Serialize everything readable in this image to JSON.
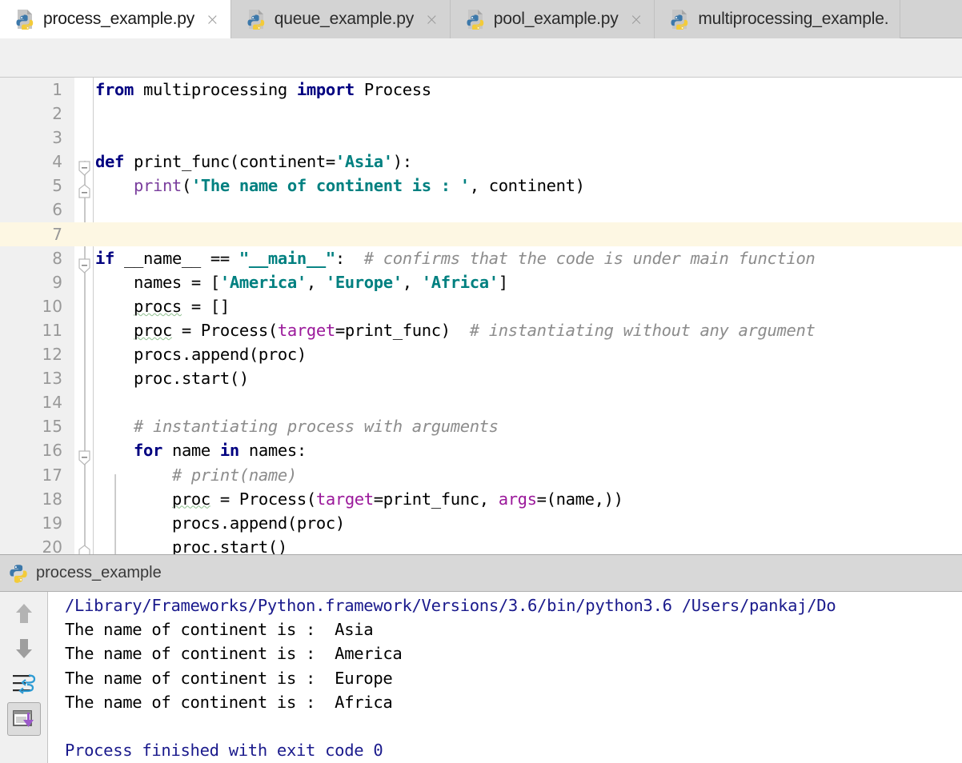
{
  "window": {
    "app": "PyCharm",
    "tabs": [
      {
        "label": "process_example.py",
        "icon": "python-file-icon",
        "active": true,
        "closable": true
      },
      {
        "label": "queue_example.py",
        "icon": "python-file-icon",
        "active": false,
        "closable": true
      },
      {
        "label": "pool_example.py",
        "icon": "python-file-icon",
        "active": false,
        "closable": true
      },
      {
        "label": "multiprocessing_example.",
        "icon": "python-file-icon",
        "active": false,
        "closable": false
      }
    ],
    "close_glyph": "×"
  },
  "editor": {
    "current_line": 7,
    "colors": {
      "keyword": "#000080",
      "string": "#008080",
      "comment": "#8c8c8c",
      "builtin": "#7a3e9d",
      "kwarg": "#9b1a9b",
      "current_line_bg": "#fdf7e3",
      "gutter_bg": "#f0f0f0"
    },
    "lines": [
      {
        "n": "1",
        "text": "from multiprocessing import Process"
      },
      {
        "n": "2",
        "text": ""
      },
      {
        "n": "3",
        "text": ""
      },
      {
        "n": "4",
        "text": "def print_func(continent='Asia'):"
      },
      {
        "n": "5",
        "text": "    print('The name of continent is : ', continent)"
      },
      {
        "n": "6",
        "text": ""
      },
      {
        "n": "7",
        "text": ""
      },
      {
        "n": "8",
        "text": "if __name__ == \"__main__\":  # confirms that the code is under main function"
      },
      {
        "n": "9",
        "text": "    names = ['America', 'Europe', 'Africa']"
      },
      {
        "n": "10",
        "text": "    procs = []"
      },
      {
        "n": "11",
        "text": "    proc = Process(target=print_func)  # instantiating without any argument"
      },
      {
        "n": "12",
        "text": "    procs.append(proc)"
      },
      {
        "n": "13",
        "text": "    proc.start()"
      },
      {
        "n": "14",
        "text": ""
      },
      {
        "n": "15",
        "text": "    # instantiating process with arguments"
      },
      {
        "n": "16",
        "text": "    for name in names:"
      },
      {
        "n": "17",
        "text": "        # print(name)"
      },
      {
        "n": "18",
        "text": "        proc = Process(target=print_func, args=(name,))"
      },
      {
        "n": "19",
        "text": "        procs.append(proc)"
      },
      {
        "n": "20",
        "text": "        proc.start()"
      }
    ]
  },
  "console": {
    "title": "process_example",
    "icon": "python-icon",
    "toolbar": [
      {
        "name": "scroll-up-button",
        "icon": "arrow-up-icon",
        "pressed": false
      },
      {
        "name": "scroll-down-button",
        "icon": "arrow-down-icon",
        "pressed": false
      },
      {
        "name": "soft-wrap-button",
        "icon": "soft-wrap-icon",
        "pressed": false
      },
      {
        "name": "scroll-to-end-button",
        "icon": "scroll-to-end-icon",
        "pressed": true
      }
    ],
    "output": [
      {
        "text": "/Library/Frameworks/Python.framework/Versions/3.6/bin/python3.6 /Users/pankaj/Do",
        "style": "link"
      },
      {
        "text": "The name of continent is :  Asia",
        "style": "plain"
      },
      {
        "text": "The name of continent is :  America",
        "style": "plain"
      },
      {
        "text": "The name of continent is :  Europe",
        "style": "plain"
      },
      {
        "text": "The name of continent is :  Africa",
        "style": "plain"
      },
      {
        "text": " ",
        "style": "blank"
      },
      {
        "text": "Process finished with exit code 0",
        "style": "exit"
      }
    ]
  }
}
